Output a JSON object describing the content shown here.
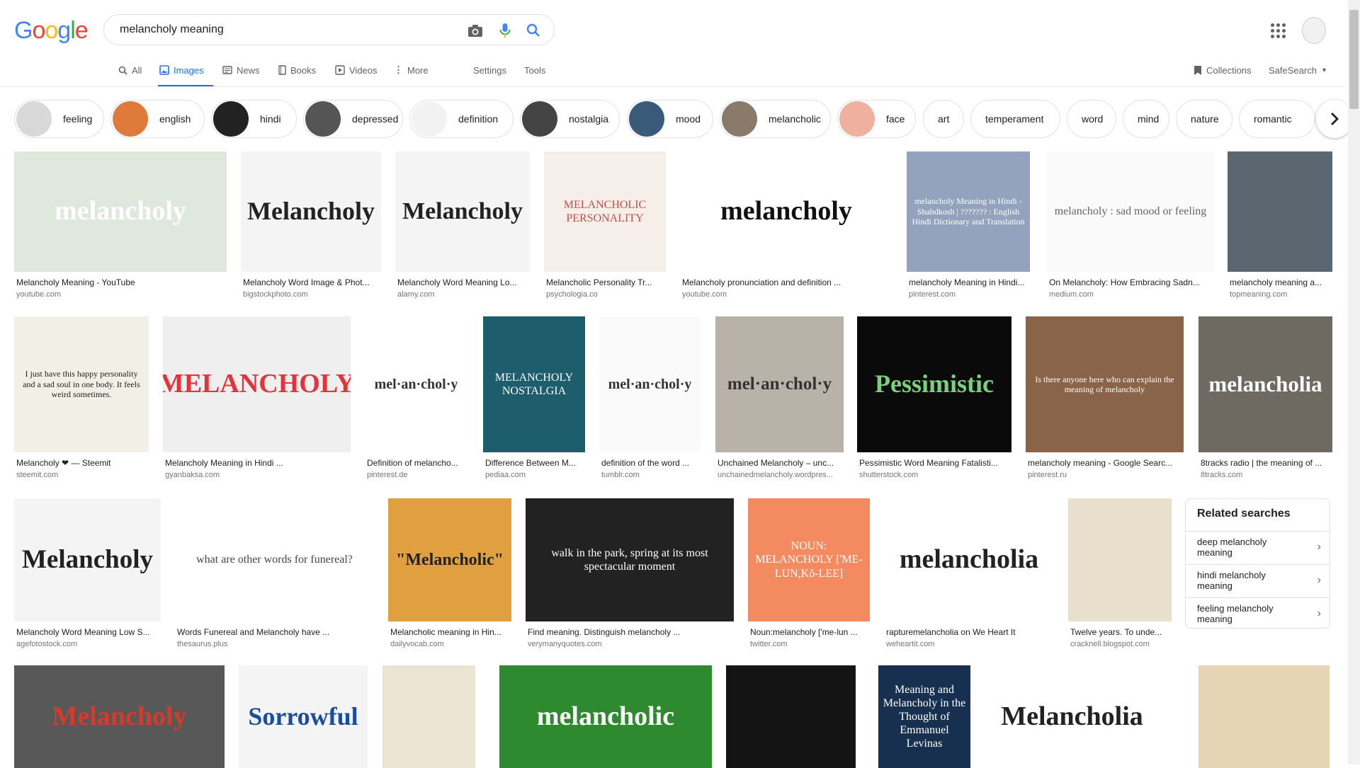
{
  "logo": {
    "letters": [
      "G",
      "o",
      "o",
      "g",
      "l",
      "e"
    ],
    "colors": [
      "#4285f4",
      "#ea4335",
      "#fbbc05",
      "#4285f4",
      "#34a853",
      "#ea4335"
    ]
  },
  "search": {
    "value": "melancholy meaning",
    "placeholder": ""
  },
  "icons": {
    "camera": "camera-icon",
    "mic": "mic-icon",
    "search": "search-icon",
    "apps": "apps-icon"
  },
  "tabs": {
    "all": "All",
    "images": "Images",
    "news": "News",
    "books": "Books",
    "videos": "Videos",
    "more": "More",
    "settings": "Settings",
    "tools": "Tools",
    "collections": "Collections",
    "safesearch": "SafeSearch"
  },
  "chips": [
    {
      "label": "feeling",
      "color": "#d8d8d8"
    },
    {
      "label": "english",
      "color": "#e07a3a"
    },
    {
      "label": "hindi",
      "color": "#222222"
    },
    {
      "label": "depressed",
      "color": "#555555"
    },
    {
      "label": "definition",
      "color": "#f2f2f2"
    },
    {
      "label": "nostalgia",
      "color": "#444444"
    },
    {
      "label": "mood",
      "color": "#3a5a7a"
    },
    {
      "label": "melancholic",
      "color": "#8a7a6a"
    },
    {
      "label": "face",
      "color": "#f0b0a0"
    },
    {
      "label": "art",
      "color": ""
    },
    {
      "label": "temperament",
      "color": ""
    },
    {
      "label": "word",
      "color": ""
    },
    {
      "label": "mind",
      "color": ""
    },
    {
      "label": "nature",
      "color": ""
    },
    {
      "label": "romantic",
      "color": ""
    }
  ],
  "results": [
    {
      "cap": "Melancholy Meaning - YouTube",
      "src": "youtube.com",
      "art": "melancholy",
      "bg": "#dfe8dc",
      "fg": "#ffffff"
    },
    {
      "cap": "Melancholy Word Image & Phot...",
      "src": "bigstockphoto.com",
      "art": "Melancholy",
      "bg": "#f4f4f4",
      "fg": "#222222"
    },
    {
      "cap": "Melancholy Word Meaning Lo...",
      "src": "alamy.com",
      "art": "Melancholy",
      "bg": "#f4f4f4",
      "fg": "#222222"
    },
    {
      "cap": "Melancholic Personality Tr...",
      "src": "psychologia.co",
      "art": "MELANCHOLIC PERSONALITY",
      "bg": "#f6eee8",
      "fg": "#c0504d"
    },
    {
      "cap": "Melancholy pronunciation and definition ...",
      "src": "youtube.com",
      "art": "melancholy",
      "bg": "#ffffff",
      "fg": "#111111"
    },
    {
      "cap": "melancholy Meaning in Hindi...",
      "src": "pinterest.com",
      "art": "melancholy Meaning in Hindi - Shabdkosh | ??????? : English Hindi Dictionary and Translation",
      "bg": "#94a3bd",
      "fg": "#ffffff"
    },
    {
      "cap": "On Melancholy: How Embracing Sadn...",
      "src": "medium.com",
      "art": "melancholy : sad mood or feeling",
      "bg": "#fafafa",
      "fg": "#666666"
    },
    {
      "cap": "melancholy meaning a...",
      "src": "topmeaning.com",
      "art": "",
      "bg": "#5a6670",
      "fg": "#ffffff"
    },
    {
      "cap": "Melancholy ❤ — Steemit",
      "src": "steemit.com",
      "art": "I just have this happy personality and a sad soul in one body. It feels weird sometimes.",
      "bg": "#f1efe6",
      "fg": "#222222"
    },
    {
      "cap": "Melancholy Meaning in Hindi ...",
      "src": "gyanbaksa.com",
      "art": "MELANCHOLY",
      "bg": "#efefef",
      "fg": "#e4343a"
    },
    {
      "cap": "Definition of melancho...",
      "src": "pinterest.de",
      "art": "mel·an·chol·y",
      "bg": "#ffffff",
      "fg": "#333333"
    },
    {
      "cap": "Difference Between M...",
      "src": "pediaa.com",
      "art": "MELANCHOLY NOSTALGIA",
      "bg": "#1e5d6b",
      "fg": "#ffffff"
    },
    {
      "cap": "definition of the word ...",
      "src": "tumblr.com",
      "art": "mel·an·chol·y",
      "bg": "#fafafa",
      "fg": "#333333"
    },
    {
      "cap": "Unchained Melancholy – unc...",
      "src": "unchainedmelancholy.wordpres...",
      "art": "mel·an·chol·y",
      "bg": "#b8b2a8",
      "fg": "#333333"
    },
    {
      "cap": "Pessimistic Word Meaning Fatalisti...",
      "src": "shutterstock.com",
      "art": "Pessimistic",
      "bg": "#0a0a0a",
      "fg": "#7bd17b"
    },
    {
      "cap": "melancholy meaning - Google Searc...",
      "src": "pinterest.ru",
      "art": "Is there anyone here who can explain the meaning of melancholy",
      "bg": "#8a6448",
      "fg": "#ffffff"
    },
    {
      "cap": "8tracks radio | the meaning of ...",
      "src": "8tracks.com",
      "art": "melancholia",
      "bg": "#6e6a62",
      "fg": "#ffffff"
    },
    {
      "cap": "Melancholy Word Meaning Low S...",
      "src": "agefotostock.com",
      "art": "Melancholy",
      "bg": "#f4f4f4",
      "fg": "#222222"
    },
    {
      "cap": "Words Funereal and Melancholy have ...",
      "src": "thesaurus.plus",
      "art": "what are other words for funereal?",
      "bg": "#ffffff",
      "fg": "#444444"
    },
    {
      "cap": "Melancholic meaning in Hin...",
      "src": "dailyvocab.com",
      "art": "\"Melancholic\"",
      "bg": "#e0a040",
      "fg": "#222222"
    },
    {
      "cap": "Find meaning. Distinguish melancholy ...",
      "src": "verymanyquotes.com",
      "art": "walk in the park, spring at its most spectacular moment",
      "bg": "#222222",
      "fg": "#ffffff"
    },
    {
      "cap": "Noun:melancholy ['me-lun ...",
      "src": "twitter.com",
      "art": "NOUN: MELANCHOLY ['ME-LUN,Kŏ-LEE]",
      "bg": "#f38a60",
      "fg": "#ffffff"
    },
    {
      "cap": "rapturemelancholia on We Heart It",
      "src": "weheartit.com",
      "art": "melancholia",
      "bg": "#ffffff",
      "fg": "#222222"
    },
    {
      "cap": "Twelve years. To unde...",
      "src": "cracknell.blogspot.com",
      "art": "",
      "bg": "#e8e0cc",
      "fg": "#555555"
    },
    {
      "cap": "",
      "src": "",
      "art": "Melancholy",
      "bg": "#585858",
      "fg": "#d83a2a"
    },
    {
      "cap": "",
      "src": "",
      "art": "Sorrowful",
      "bg": "#f4f4f4",
      "fg": "#1a4da0"
    },
    {
      "cap": "",
      "src": "",
      "art": "",
      "bg": "#ece4d2",
      "fg": "#555555"
    },
    {
      "cap": "",
      "src": "",
      "art": "melancholic",
      "bg": "#2e8a2e",
      "fg": "#ffffff"
    },
    {
      "cap": "",
      "src": "",
      "art": "",
      "bg": "#141414",
      "fg": "#ffffff"
    },
    {
      "cap": "",
      "src": "",
      "art": "Meaning and Melancholy in the Thought of Emmanuel Levinas",
      "bg": "#17304f",
      "fg": "#ffffff"
    },
    {
      "cap": "",
      "src": "",
      "art": "Melancholia",
      "bg": "#ffffff",
      "fg": "#222222"
    },
    {
      "cap": "",
      "src": "",
      "art": "",
      "bg": "#e6d4b4",
      "fg": "#555555"
    }
  ],
  "related": {
    "title": "Related searches",
    "items": [
      "deep melancholy meaning",
      "hindi melancholy meaning",
      "feeling melancholy meaning"
    ]
  }
}
